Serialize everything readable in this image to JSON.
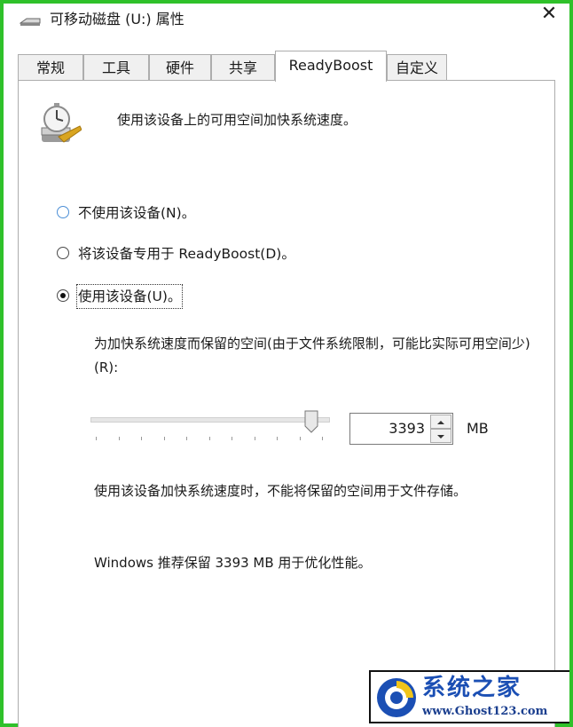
{
  "window": {
    "title": "可移动磁盘 (U:) 属性",
    "close_symbol": "✕",
    "title_icon": "drive-icon"
  },
  "tabs": [
    {
      "label": "常规",
      "active": false
    },
    {
      "label": "工具",
      "active": false
    },
    {
      "label": "硬件",
      "active": false
    },
    {
      "label": "共享",
      "active": false
    },
    {
      "label": "ReadyBoost",
      "active": true
    },
    {
      "label": "自定义",
      "active": false
    }
  ],
  "header": {
    "icon": "stopwatch-icon",
    "text": "使用该设备上的可用空间加快系统速度。"
  },
  "options": [
    {
      "label": "不使用该设备(N)。",
      "selected": false
    },
    {
      "label": "将该设备专用于 ReadyBoost(D)。",
      "selected": false
    },
    {
      "label": "使用该设备(U)。",
      "selected": true
    }
  ],
  "reserve": {
    "text": "为加快系统速度而保留的空间(由于文件系统限制，可能比实际可用空间少)(R):",
    "slider_fraction": 0.93,
    "value": "3393",
    "unit": "MB"
  },
  "notes": {
    "line1": "使用该设备加快系统速度时，不能将保留的空间用于文件存储。",
    "line2": "Windows 推荐保留 3393 MB 用于优化性能。"
  },
  "watermark": {
    "title": "系统之家",
    "url": "www.Ghost123.com"
  },
  "colors": {
    "frame": "#2fc12a",
    "watermark_blue": "#1b4fb4"
  }
}
